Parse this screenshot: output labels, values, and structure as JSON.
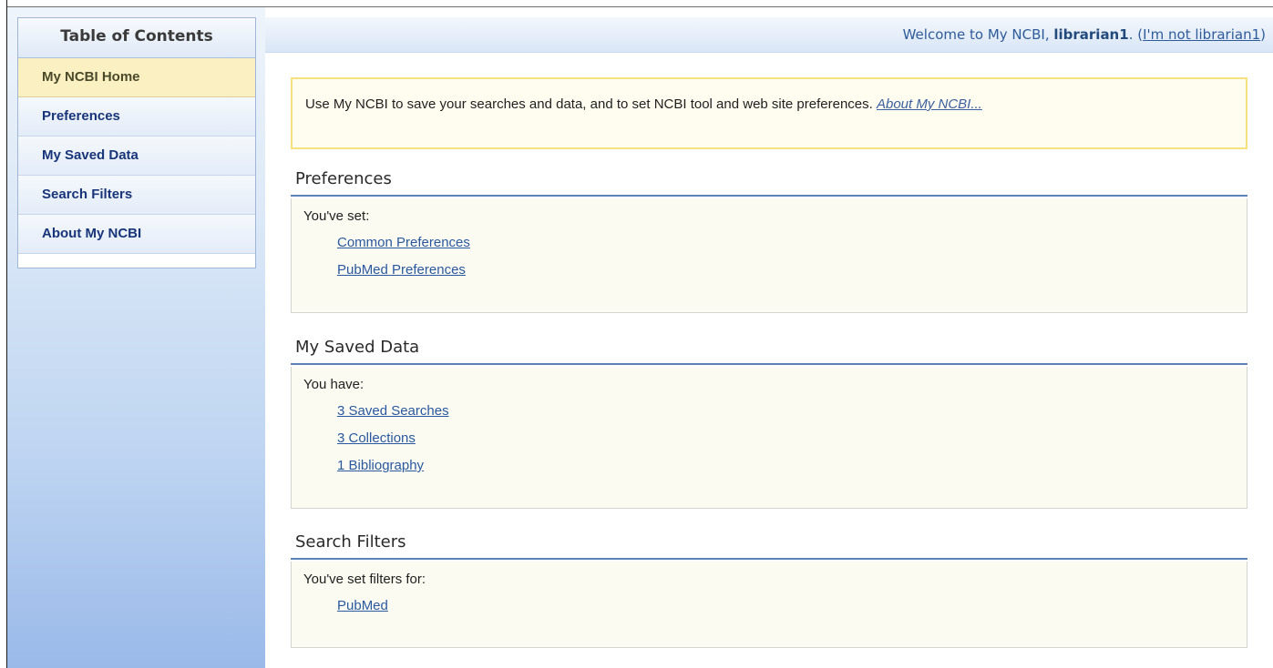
{
  "sidebar": {
    "title": "Table of Contents",
    "items": [
      {
        "label": "My NCBI Home",
        "active": true
      },
      {
        "label": "Preferences"
      },
      {
        "label": "My Saved Data"
      },
      {
        "label": "Search Filters"
      },
      {
        "label": "About My NCBI"
      }
    ]
  },
  "header": {
    "welcome_prefix": "Welcome to My NCBI, ",
    "username": "librarian1",
    "period": ". (",
    "not_me_link": "I'm not librarian1",
    "close_paren": ")"
  },
  "intro": {
    "text": "Use My NCBI to save your searches and data, and to set NCBI tool and web site preferences. ",
    "link": "About My NCBI..."
  },
  "sections": {
    "preferences": {
      "title": "Preferences",
      "label": "You've set:",
      "links": [
        "Common Preferences",
        "PubMed Preferences"
      ]
    },
    "saved_data": {
      "title": "My Saved Data",
      "label": "You have:",
      "links": [
        "3 Saved Searches",
        "3 Collections",
        "1 Bibliography"
      ]
    },
    "search_filters": {
      "title": "Search Filters",
      "label": "You've set filters for:",
      "links": [
        "PubMed"
      ]
    }
  }
}
